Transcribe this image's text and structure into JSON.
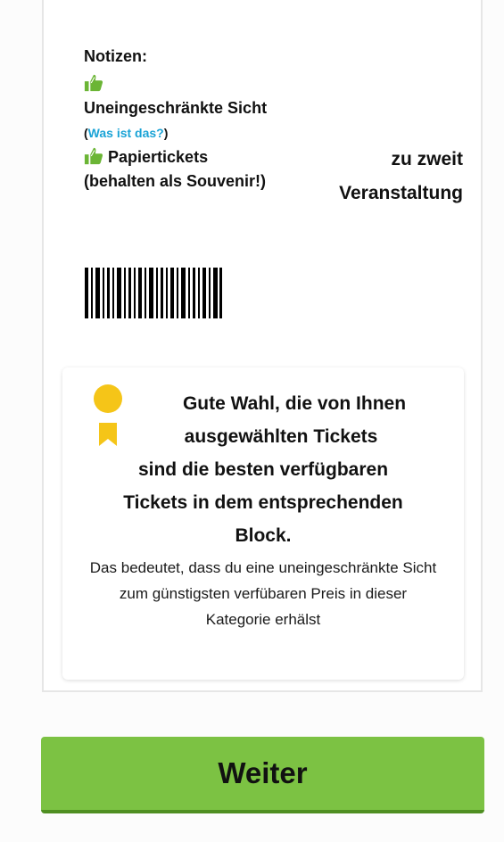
{
  "ticket": {
    "notes_heading": "Notizen:",
    "notes": {
      "unobstructed_label": "Uneingeschränkte Sicht",
      "info_open": "(",
      "info_link": "Was ist das?",
      "info_close": ")",
      "paper_label": "Papiertickets (behalten als Souvenir!)"
    },
    "quantity_line": "zu zweit",
    "event_line": "Veranstaltung"
  },
  "info_box": {
    "title_line1": "Gute Wahl, die von Ihnen",
    "title_line2": "ausgewählten Tickets",
    "title_line3": "sind die besten verfügbaren",
    "title_line4": "Tickets in dem entsprechenden",
    "title_line5": "Block.",
    "text": "Das bedeutet, dass du eine uneingeschränkte Sicht zum günstigsten verfübaren Preis in dieser Kategorie erhälst"
  },
  "continue_button_label": "Weiter",
  "icons": {
    "thumb": "thumbs-up-icon",
    "medal": "medal-icon",
    "barcode": "barcode-icon"
  },
  "colors": {
    "accent_green": "#7cc243",
    "thumb_green": "#6bb535",
    "link_blue": "#1aa3d6",
    "medal_gold": "#f5c518"
  }
}
